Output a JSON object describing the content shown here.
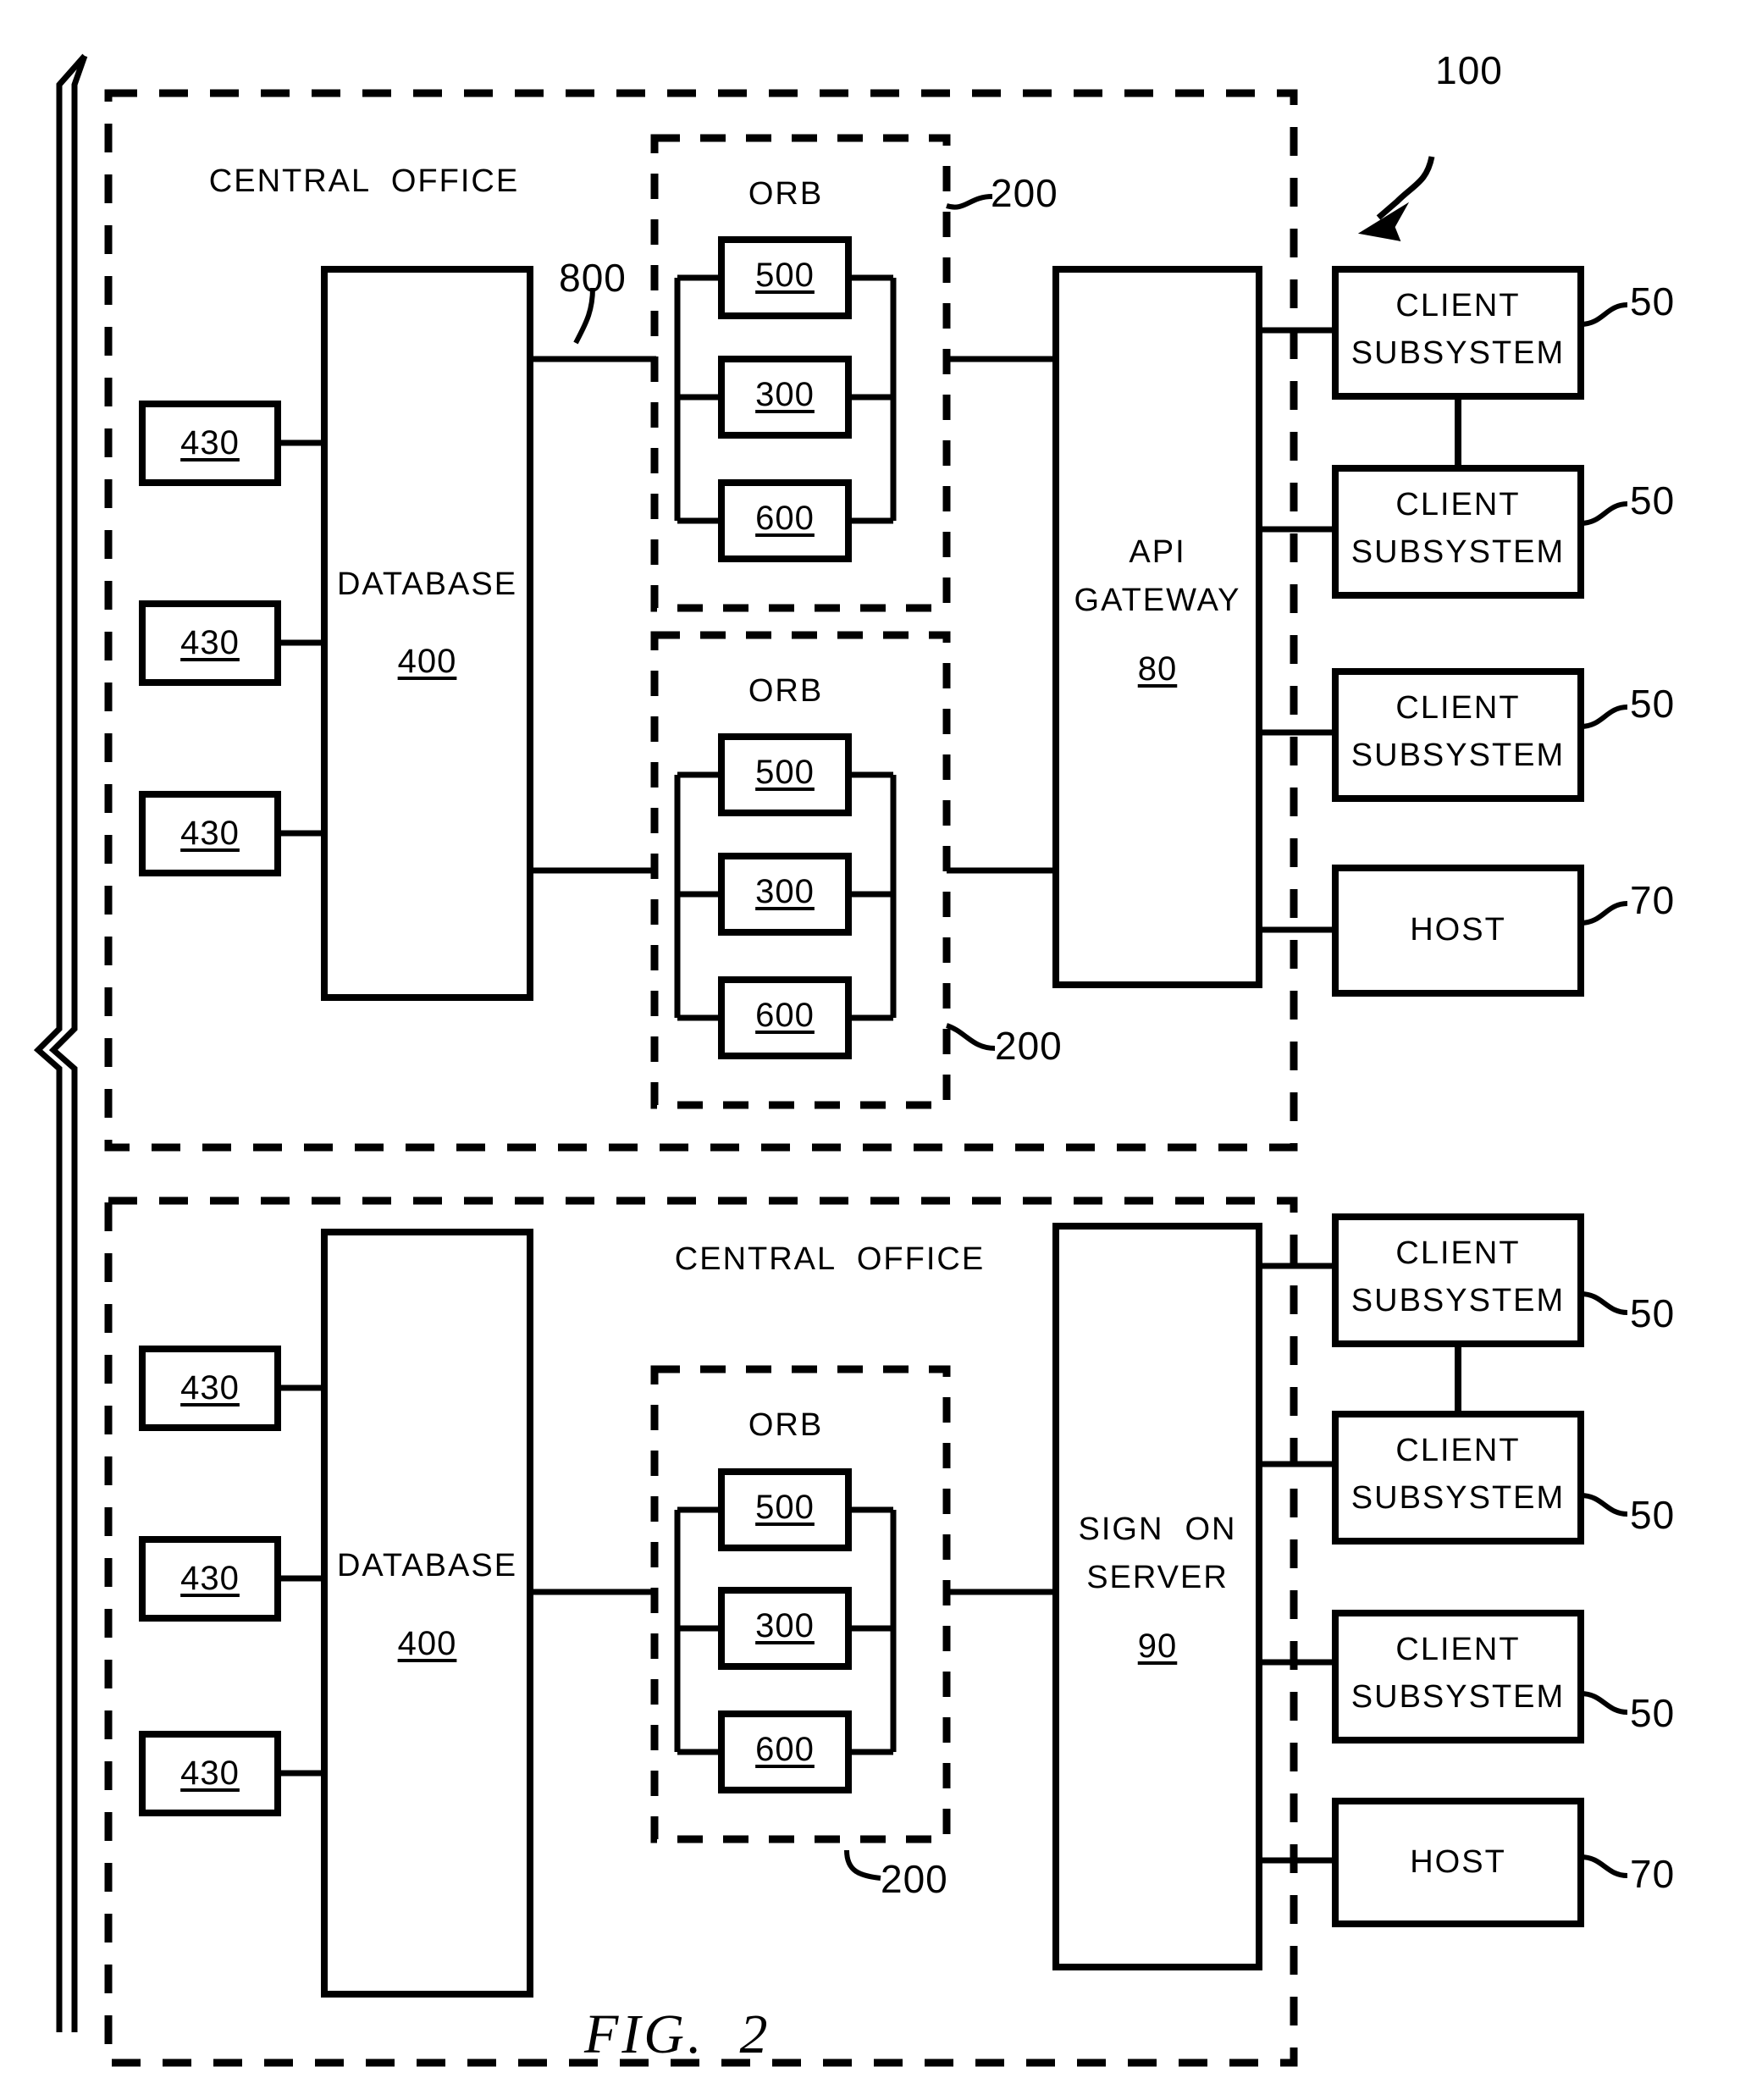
{
  "figure": {
    "label": "FIG.  2",
    "system_ref": "100"
  },
  "top_section": {
    "title": "CENTRAL  OFFICE",
    "database": {
      "label": "DATABASE",
      "ref": "400"
    },
    "terminals": [
      {
        "ref": "430"
      },
      {
        "ref": "430"
      },
      {
        "ref": "430"
      }
    ],
    "bus_ref": "800",
    "orbs": [
      {
        "label": "ORB",
        "ref": "200",
        "nodes": [
          {
            "ref": "500"
          },
          {
            "ref": "300"
          },
          {
            "ref": "600"
          }
        ]
      },
      {
        "label": "ORB",
        "ref": "200",
        "nodes": [
          {
            "ref": "500"
          },
          {
            "ref": "300"
          },
          {
            "ref": "600"
          }
        ]
      }
    ],
    "gateway": {
      "line1": "API",
      "line2": "GATEWAY",
      "ref": "80"
    },
    "clients": [
      {
        "line1": "CLIENT",
        "line2": "SUBSYSTEM",
        "ref": "50"
      },
      {
        "line1": "CLIENT",
        "line2": "SUBSYSTEM",
        "ref": "50"
      },
      {
        "line1": "CLIENT",
        "line2": "SUBSYSTEM",
        "ref": "50"
      }
    ],
    "host": {
      "label": "HOST",
      "ref": "70"
    }
  },
  "bottom_section": {
    "title": "CENTRAL  OFFICE",
    "database": {
      "label": "DATABASE",
      "ref": "400"
    },
    "terminals": [
      {
        "ref": "430"
      },
      {
        "ref": "430"
      },
      {
        "ref": "430"
      }
    ],
    "orbs": [
      {
        "label": "ORB",
        "ref": "200",
        "nodes": [
          {
            "ref": "500"
          },
          {
            "ref": "300"
          },
          {
            "ref": "600"
          }
        ]
      }
    ],
    "server": {
      "line1": "SIGN  ON",
      "line2": "SERVER",
      "ref": "90"
    },
    "clients": [
      {
        "line1": "CLIENT",
        "line2": "SUBSYSTEM",
        "ref": "50"
      },
      {
        "line1": "CLIENT",
        "line2": "SUBSYSTEM",
        "ref": "50"
      },
      {
        "line1": "CLIENT",
        "line2": "SUBSYSTEM",
        "ref": "50"
      }
    ],
    "host": {
      "label": "HOST",
      "ref": "70"
    }
  },
  "colors": {
    "ink": "#000000",
    "paper": "#ffffff"
  }
}
